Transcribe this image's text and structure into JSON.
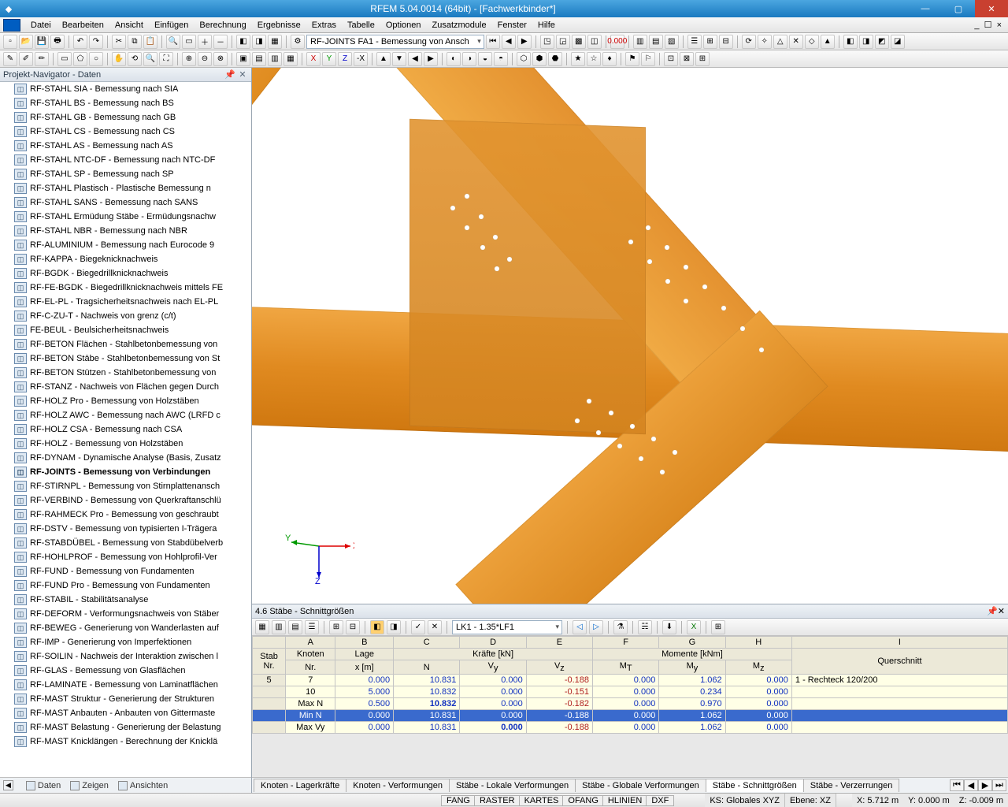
{
  "title": "RFEM 5.04.0014 (64bit) - [Fachwerkbinder*]",
  "menu": [
    "Datei",
    "Bearbeiten",
    "Ansicht",
    "Einfügen",
    "Berechnung",
    "Ergebnisse",
    "Extras",
    "Tabelle",
    "Optionen",
    "Zusatzmodule",
    "Fenster",
    "Hilfe"
  ],
  "toolbar_combo": "RF-JOINTS FA1 - Bemessung von Ansch",
  "navigator": {
    "title": "Projekt-Navigator - Daten",
    "items": [
      "RF-STAHL SIA - Bemessung nach SIA",
      "RF-STAHL BS - Bemessung nach BS",
      "RF-STAHL GB - Bemessung nach GB",
      "RF-STAHL CS - Bemessung nach CS",
      "RF-STAHL AS - Bemessung nach AS",
      "RF-STAHL NTC-DF - Bemessung nach NTC-DF",
      "RF-STAHL SP - Bemessung nach SP",
      "RF-STAHL Plastisch - Plastische Bemessung n",
      "RF-STAHL SANS - Bemessung nach SANS",
      "RF-STAHL Ermüdung Stäbe - Ermüdungsnachw",
      "RF-STAHL NBR - Bemessung nach NBR",
      "RF-ALUMINIUM - Bemessung nach Eurocode 9",
      "RF-KAPPA - Biegeknicknachweis",
      "RF-BGDK - Biegedrillknicknachweis",
      "RF-FE-BGDK - Biegedrillknicknachweis mittels FE",
      "RF-EL-PL - Tragsicherheitsnachweis nach EL-PL",
      "RF-C-ZU-T - Nachweis von grenz (c/t)",
      "FE-BEUL - Beulsicherheitsnachweis",
      "RF-BETON Flächen - Stahlbetonbemessung von",
      "RF-BETON Stäbe - Stahlbetonbemessung von St",
      "RF-BETON Stützen - Stahlbetonbemessung von",
      "RF-STANZ - Nachweis von Flächen gegen Durch",
      "RF-HOLZ Pro - Bemessung von Holzstäben",
      "RF-HOLZ AWC - Bemessung nach AWC (LRFD c",
      "RF-HOLZ CSA - Bemessung nach CSA",
      "RF-HOLZ - Bemessung von Holzstäben",
      "RF-DYNAM - Dynamische Analyse (Basis, Zusatz",
      "RF-JOINTS - Bemessung von Verbindungen",
      "RF-STIRNPL - Bemessung von Stirnplattenansch",
      "RF-VERBIND - Bemessung von Querkraftanschlü",
      "RF-RAHMECK Pro - Bemessung von geschraubt",
      "RF-DSTV - Bemessung von typisierten I-Trägera",
      "RF-STABDÜBEL - Bemessung von Stabdübelverb",
      "RF-HOHLPROF - Bemessung von Hohlprofil-Ver",
      "RF-FUND - Bemessung von Fundamenten",
      "RF-FUND Pro - Bemessung von Fundamenten",
      "RF-STABIL - Stabilitätsanalyse",
      "RF-DEFORM - Verformungsnachweis von Stäber",
      "RF-BEWEG - Generierung von Wanderlasten auf",
      "RF-IMP - Generierung von Imperfektionen",
      "RF-SOILIN - Nachweis der Interaktion zwischen l",
      "RF-GLAS - Bemessung von Glasflächen",
      "RF-LAMINATE - Bemessung von Laminatflächen",
      "RF-MAST Struktur - Generierung der Strukturen",
      "RF-MAST Anbauten - Anbauten von Gittermaste",
      "RF-MAST Belastung - Generierung der Belastung",
      "RF-MAST Knicklängen - Berechnung der Knicklä"
    ],
    "selected_index": 27,
    "tabs": [
      "Daten",
      "Zeigen",
      "Ansichten"
    ]
  },
  "table_panel": {
    "title": "4.6 Stäbe - Schnittgrößen",
    "combo": "LK1 - 1.35*LF1",
    "cols_letters": [
      "A",
      "B",
      "C",
      "D",
      "E",
      "F",
      "G",
      "H",
      "I"
    ],
    "head1": {
      "stab": "Stab",
      "knoten": "Knoten",
      "lage": "Lage",
      "krafte": "Kräfte [kN]",
      "momente": "Momente [kNm]",
      "quer": "Querschnitt"
    },
    "head2": {
      "nr": "Nr.",
      "knr": "Nr.",
      "x": "x [m]",
      "N": "N",
      "Vy": "Vy",
      "Vz": "Vz",
      "MT": "MT",
      "My": "My",
      "Mz": "Mz"
    },
    "rows": [
      {
        "stab": "5",
        "kn": "7",
        "x": "0.000",
        "N": "10.831",
        "Vy": "0.000",
        "Vz": "-0.188",
        "MT": "0.000",
        "My": "1.062",
        "Mz": "0.000",
        "q": "1 - Rechteck 120/200"
      },
      {
        "stab": "",
        "kn": "10",
        "x": "5.000",
        "N": "10.832",
        "Vy": "0.000",
        "Vz": "-0.151",
        "MT": "0.000",
        "My": "0.234",
        "Mz": "0.000",
        "q": ""
      },
      {
        "stab": "",
        "kn": "Max N",
        "x": "0.500",
        "N": "10.832",
        "Nb": true,
        "Vy": "0.000",
        "Vz": "-0.182",
        "MT": "0.000",
        "My": "0.970",
        "Mz": "0.000",
        "q": ""
      },
      {
        "stab": "",
        "kn": "Min N",
        "x": "0.000",
        "N": "10.831",
        "Vy": "0.000",
        "Vz": "-0.188",
        "MT": "0.000",
        "My": "1.062",
        "Mz": "0.000",
        "q": "",
        "hl": true
      },
      {
        "stab": "",
        "kn": "Max Vy",
        "x": "0.000",
        "N": "10.831",
        "Vy": "0.000",
        "Vyb": true,
        "Vz": "-0.188",
        "MT": "0.000",
        "My": "1.062",
        "Mz": "0.000",
        "q": ""
      }
    ],
    "bottom_tabs": [
      "Knoten - Lagerkräfte",
      "Knoten - Verformungen",
      "Stäbe - Lokale Verformungen",
      "Stäbe - Globale Verformungen",
      "Stäbe - Schnittgrößen",
      "Stäbe - Verzerrungen"
    ],
    "bottom_active": 4
  },
  "status": {
    "toggles": [
      "FANG",
      "RASTER",
      "KARTES",
      "OFANG",
      "HLINIEN",
      "DXF"
    ],
    "ks": "KS: Globales XYZ",
    "ebene": "Ebene: XZ",
    "x": "X: 5.712 m",
    "y": "Y: 0.000 m",
    "z": "Z: -0.009 m"
  }
}
